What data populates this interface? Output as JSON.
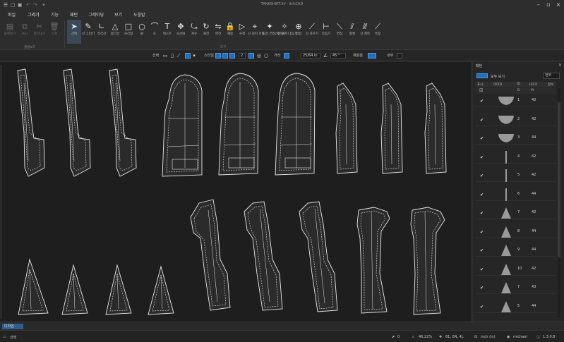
{
  "window": {
    "title": "TANKSHIRT.ihf - ihfsCAD"
  },
  "menu": {
    "items": [
      "파일",
      "그리기",
      "기능",
      "패턴",
      "그레이딩",
      "보기",
      "도움말"
    ],
    "active_index": 1
  },
  "ribbon": {
    "clipboard": {
      "group_label": "클립보드",
      "buttons": [
        {
          "label": "붙여넣기",
          "icon": "paste-icon"
        },
        {
          "label": "복사",
          "icon": "copy-icon"
        },
        {
          "label": "잘라내기",
          "icon": "cut-icon"
        },
        {
          "label": "삭제",
          "icon": "delete-icon"
        }
      ]
    },
    "tools": {
      "group_label": "도구",
      "buttons": [
        {
          "label": "선택",
          "icon": "select-arrow-icon"
        },
        {
          "label": "선 그리기",
          "icon": "pen-icon"
        },
        {
          "label": "직각선",
          "icon": "right-angle-icon"
        },
        {
          "label": "좀더선",
          "icon": "angle-icon"
        },
        {
          "label": "사각형",
          "icon": "rectangle-icon"
        },
        {
          "label": "원",
          "icon": "circle-icon"
        },
        {
          "label": "호",
          "icon": "arc-icon"
        },
        {
          "label": "텍스트",
          "icon": "text-icon"
        },
        {
          "label": "곡선화",
          "icon": "move-icon"
        },
        {
          "label": "자유",
          "icon": "freehand-icon"
        },
        {
          "label": "회전",
          "icon": "rotate-icon"
        },
        {
          "label": "반전",
          "icon": "mirror-icon"
        },
        {
          "label": "재봉",
          "icon": "sew-icon"
        },
        {
          "label": "수정",
          "icon": "edit-icon"
        },
        {
          "label": "선 길이 조절",
          "icon": "length-icon"
        },
        {
          "label": "곡선 연장/자르기",
          "icon": "extend-icon"
        },
        {
          "label": "선 붙여 다듬기",
          "icon": "trim-icon"
        },
        {
          "label": "병합",
          "icon": "merge-icon"
        },
        {
          "label": "선 자르기",
          "icon": "split-icon"
        },
        {
          "label": "다듬기",
          "icon": "smooth-icon"
        },
        {
          "label": "연장",
          "icon": "extend-line-icon"
        },
        {
          "label": "평행",
          "icon": "parallel-icon"
        },
        {
          "label": "선 계측",
          "icon": "measure-line-icon"
        },
        {
          "label": "측정",
          "icon": "ruler-icon"
        }
      ]
    }
  },
  "propbar": {
    "select_label": "선택",
    "style_label": "스타일",
    "width_value": "2",
    "dist_label": "거리",
    "dist_value": "25/64 in",
    "angle_value": "45 °",
    "snap_label": "재원점",
    "drag_label": "내부"
  },
  "panel": {
    "title": "패턴",
    "show_all_label": "모두 보기",
    "select_value": "전부",
    "columns": [
      "표시",
      "이미지",
      "ID",
      "사이즈",
      "정보"
    ],
    "items": [
      {
        "id": "1",
        "size": "42",
        "shape": "collar"
      },
      {
        "id": "2",
        "size": "42",
        "shape": "collar"
      },
      {
        "id": "3",
        "size": "44",
        "shape": "collar"
      },
      {
        "id": "4",
        "size": "42",
        "shape": "line"
      },
      {
        "id": "5",
        "size": "42",
        "shape": "line"
      },
      {
        "id": "6",
        "size": "44",
        "shape": "line"
      },
      {
        "id": "7",
        "size": "42",
        "shape": "triangle"
      },
      {
        "id": "8",
        "size": "44",
        "shape": "triangle"
      },
      {
        "id": "9",
        "size": "44",
        "shape": "triangle"
      },
      {
        "id": "10",
        "size": "42",
        "shape": "triangle"
      },
      {
        "id": "7",
        "size": "43",
        "shape": "triangle"
      },
      {
        "id": "5",
        "size": "44",
        "shape": "triangle"
      }
    ]
  },
  "bottom_tab": {
    "label": "디자인"
  },
  "status": {
    "left": "선택",
    "count": "0",
    "zoom": "46.22%",
    "coords": "61, 0N, 4L",
    "unit": "inch (in)",
    "user": "michael",
    "version": "1.3.0.8"
  },
  "colors": {
    "accent": "#1f6fbf",
    "canvas": "#1e1e1e",
    "pattern_fill": "#2b2b2b",
    "pattern_line": "#e8e8e8"
  }
}
